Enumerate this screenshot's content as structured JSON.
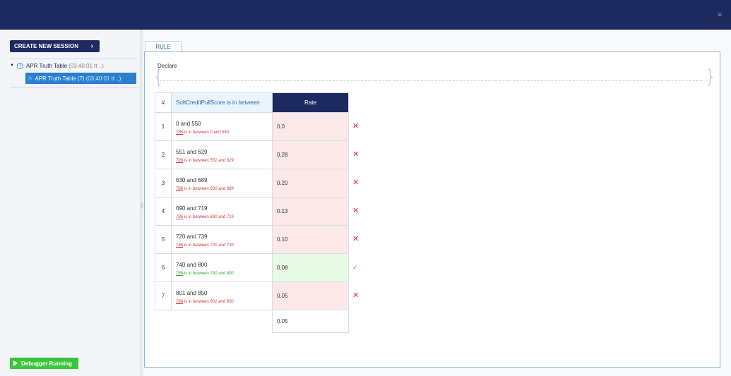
{
  "window": {
    "close_glyph": "×"
  },
  "sidebar": {
    "new_session_label": "CREATE NEW SESSION",
    "tree_root_label": "APR Truth Table",
    "tree_root_time": "(03:40:01 tt ..)",
    "tree_child_label": "APR Truth Table (7)",
    "tree_child_time": "(03:40:01 tt ..)",
    "debugger_label": "Debugger Running"
  },
  "main": {
    "tab_label": "RULE",
    "declare_label": "Declare",
    "table": {
      "headers": {
        "num": "#",
        "condition": "SoftCreditPullScore is in between",
        "rate": "Rate"
      },
      "rows": [
        {
          "num": "1",
          "condition": "0 and 550",
          "var": "786",
          "between": "is in between",
          "range": "0 and 550",
          "rate": "0.0",
          "status": "fail"
        },
        {
          "num": "2",
          "condition": "551 and 629",
          "var": "786",
          "between": "is in between",
          "range": "551 and 629",
          "rate": "0.28",
          "status": "fail"
        },
        {
          "num": "3",
          "condition": "630 and 689",
          "var": "786",
          "between": "is in between",
          "range": "630 and 689",
          "rate": "0.20",
          "status": "fail"
        },
        {
          "num": "4",
          "condition": "690 and 719",
          "var": "786",
          "between": "is in between",
          "range": "690 and 719",
          "rate": "0.13",
          "status": "fail"
        },
        {
          "num": "5",
          "condition": "720 and 739",
          "var": "786",
          "between": "is in between",
          "range": "720 and 739",
          "rate": "0.10",
          "status": "fail"
        },
        {
          "num": "6",
          "condition": "740 and 800",
          "var": "786",
          "between": "is in between",
          "range": "740 and 800",
          "rate": "0.08",
          "status": "pass"
        },
        {
          "num": "7",
          "condition": "801 and 850",
          "var": "786",
          "between": "is in between",
          "range": "801 and 850",
          "rate": "0.05",
          "status": "fail"
        }
      ],
      "default_rate": "0.05"
    }
  },
  "colors": {
    "header_navy": "#1d2a60",
    "fail_red": "#d72a2a",
    "pass_green": "#3bb43b",
    "accent_blue": "#2a7fd0"
  }
}
